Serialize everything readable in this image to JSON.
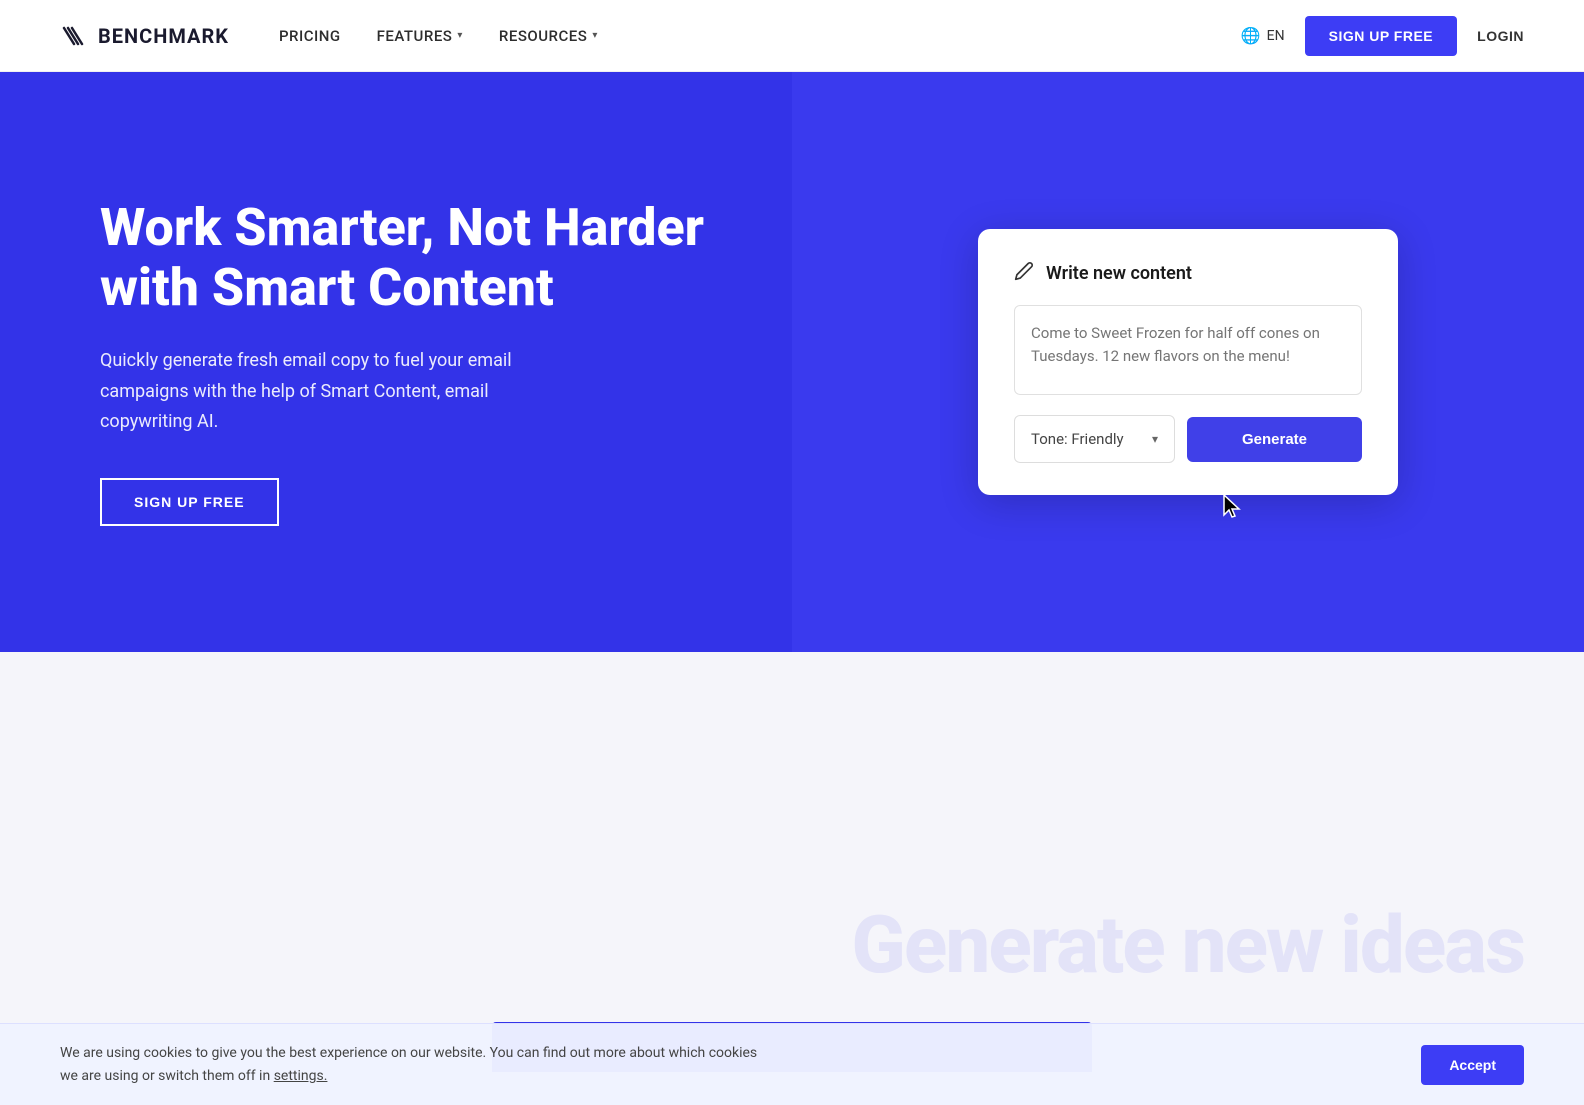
{
  "navbar": {
    "logo_text": "BENCHMARK",
    "nav_items": [
      {
        "label": "PRICING",
        "has_dropdown": false
      },
      {
        "label": "FEATURES",
        "has_dropdown": true
      },
      {
        "label": "RESOURCES",
        "has_dropdown": true
      }
    ],
    "lang": "EN",
    "signup_label": "SIGN UP FREE",
    "login_label": "LOGIN"
  },
  "hero": {
    "title": "Work Smarter, Not Harder with Smart Content",
    "subtitle": "Quickly generate fresh email copy to fuel your email campaigns with the help of Smart Content, email copywriting AI.",
    "cta_label": "SIGN UP FREE"
  },
  "smart_content_card": {
    "header_label": "Write new content",
    "textarea_placeholder": "Come to Sweet Frozen for half off cones on Tuesdays. 12 new flavors on the menu!",
    "tone_label": "Tone: Friendly",
    "generate_label": "Generate"
  },
  "cookie_banner": {
    "text": "We are using cookies to give you the best experience on our website. You can find out more about which cookies we are using or switch them off in",
    "settings_link": "settings.",
    "accept_label": "Accept"
  },
  "lower_section": {
    "generate_ideas_text": "Generate new ideas"
  },
  "colors": {
    "primary_blue": "#3333e8",
    "accent_blue": "#4040e8",
    "white": "#ffffff",
    "dark": "#1a1a1a"
  }
}
